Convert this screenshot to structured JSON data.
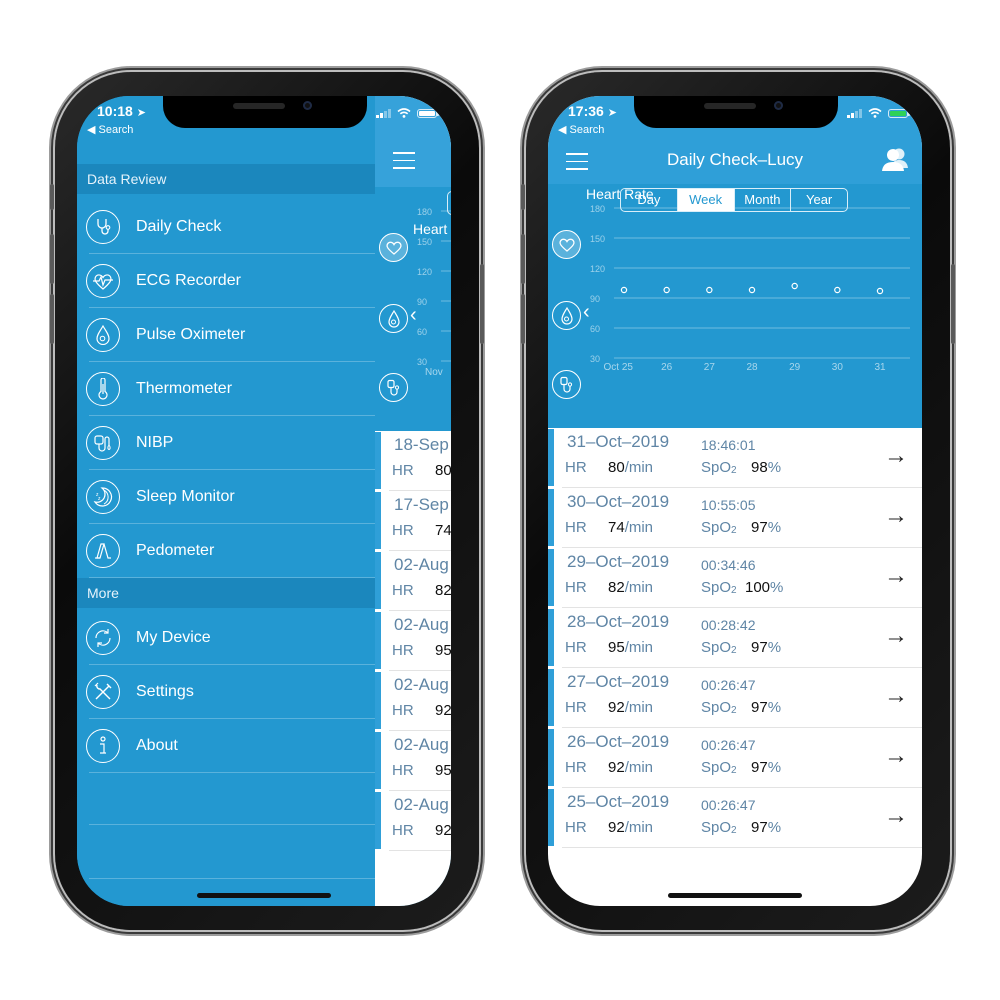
{
  "left_phone": {
    "status": {
      "time": "10:18",
      "back_label": "Search",
      "battery_color": "#ffffff"
    },
    "drawer": {
      "sections": [
        {
          "title": "Data Review"
        },
        {
          "title": "More"
        }
      ],
      "items": [
        {
          "label": "Daily Check",
          "icon": "stethoscope-icon"
        },
        {
          "label": "ECG Recorder",
          "icon": "heart-ecg-icon"
        },
        {
          "label": "Pulse Oximeter",
          "icon": "oxygen-drop-icon"
        },
        {
          "label": "Thermometer",
          "icon": "thermometer-icon"
        },
        {
          "label": "NIBP",
          "icon": "blood-pressure-cuff-icon"
        },
        {
          "label": "Sleep Monitor",
          "icon": "moon-sleep-icon"
        },
        {
          "label": "Pedometer",
          "icon": "footsteps-icon"
        },
        {
          "label": "My Device",
          "icon": "sync-device-icon"
        },
        {
          "label": "Settings",
          "icon": "wrench-screwdriver-icon"
        },
        {
          "label": "About",
          "icon": "info-icon"
        }
      ]
    },
    "peek": {
      "chart_title": "Heart",
      "y_ticks": [
        "180",
        "150",
        "120",
        "90",
        "60",
        "30"
      ],
      "x_first": "Nov",
      "rows": [
        {
          "date": "18-Sep",
          "hr_label": "HR",
          "hr": "80"
        },
        {
          "date": "17-Sep",
          "hr_label": "HR",
          "hr": "74"
        },
        {
          "date": "02-Aug",
          "hr_label": "HR",
          "hr": "82"
        },
        {
          "date": "02-Aug",
          "hr_label": "HR",
          "hr": "95"
        },
        {
          "date": "02-Aug",
          "hr_label": "HR",
          "hr": "92"
        },
        {
          "date": "02-Aug",
          "hr_label": "HR",
          "hr": "95"
        },
        {
          "date": "02-Aug",
          "hr_label": "HR",
          "hr": "92"
        }
      ]
    }
  },
  "right_phone": {
    "status": {
      "time": "17:36",
      "back_label": "Search",
      "battery_color": "#2ed158"
    },
    "header": {
      "title": "Daily Check–Lucy",
      "menu_icon": "hamburger-icon",
      "user_icon": "users-icon"
    },
    "tabs": [
      {
        "label": "Day",
        "active": false
      },
      {
        "label": "Week",
        "active": true
      },
      {
        "label": "Month",
        "active": false
      },
      {
        "label": "Year",
        "active": false
      }
    ],
    "side_icons": [
      "heart-icon",
      "oxygen-drop-icon",
      "blood-pressure-icon"
    ],
    "records": [
      {
        "date": "31–Oct–2019",
        "time": "18:46:01",
        "hr_label": "HR",
        "hr": "80",
        "hr_unit": "/min",
        "spo2_label": "SpO",
        "spo2_sub": "2",
        "spo2": "98",
        "spo2_unit": "%"
      },
      {
        "date": "30–Oct–2019",
        "time": "10:55:05",
        "hr_label": "HR",
        "hr": "74",
        "hr_unit": "/min",
        "spo2_label": "SpO",
        "spo2_sub": "2",
        "spo2": "97",
        "spo2_unit": "%"
      },
      {
        "date": "29–Oct–2019",
        "time": "00:34:46",
        "hr_label": "HR",
        "hr": "82",
        "hr_unit": "/min",
        "spo2_label": "SpO",
        "spo2_sub": "2",
        "spo2": "100",
        "spo2_unit": "%"
      },
      {
        "date": "28–Oct–2019",
        "time": "00:28:42",
        "hr_label": "HR",
        "hr": "95",
        "hr_unit": "/min",
        "spo2_label": "SpO",
        "spo2_sub": "2",
        "spo2": "97",
        "spo2_unit": "%"
      },
      {
        "date": "27–Oct–2019",
        "time": "00:26:47",
        "hr_label": "HR",
        "hr": "92",
        "hr_unit": "/min",
        "spo2_label": "SpO",
        "spo2_sub": "2",
        "spo2": "97",
        "spo2_unit": "%"
      },
      {
        "date": "26–Oct–2019",
        "time": "00:26:47",
        "hr_label": "HR",
        "hr": "92",
        "hr_unit": "/min",
        "spo2_label": "SpO",
        "spo2_sub": "2",
        "spo2": "97",
        "spo2_unit": "%"
      },
      {
        "date": "25–Oct–2019",
        "time": "00:26:47",
        "hr_label": "HR",
        "hr": "92",
        "hr_unit": "/min",
        "spo2_label": "SpO",
        "spo2_sub": "2",
        "spo2": "97",
        "spo2_unit": "%"
      }
    ]
  },
  "chart_data": {
    "type": "scatter",
    "title": "Heart Rate",
    "x": [
      "Oct 25",
      "26",
      "27",
      "28",
      "29",
      "30",
      "31"
    ],
    "values": [
      98,
      98,
      98,
      98,
      102,
      98,
      97
    ],
    "y_ticks": [
      180,
      150,
      120,
      90,
      60,
      30
    ],
    "ylim": [
      30,
      180
    ],
    "grid": true,
    "xlabel": "",
    "ylabel": ""
  },
  "colors": {
    "primary": "#2398d0",
    "header": "#2f9fd8",
    "section": "#1b87bd",
    "muted_text": "#5f85a5"
  }
}
